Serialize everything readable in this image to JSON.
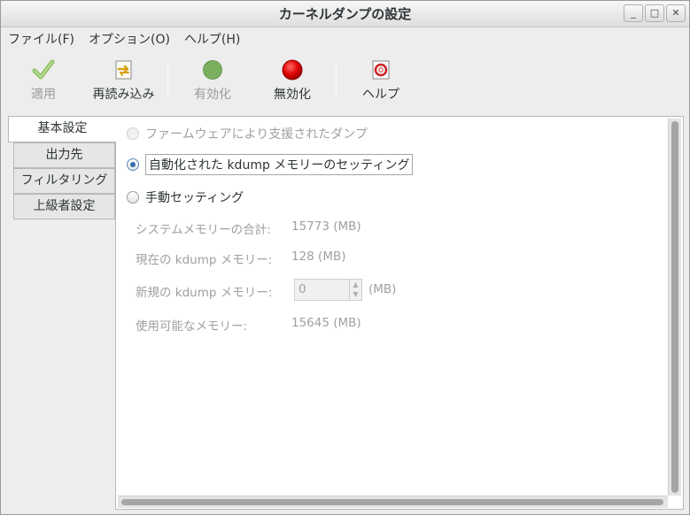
{
  "window": {
    "title": "カーネルダンプの設定",
    "minimize_label": "_",
    "maximize_label": "□",
    "close_label": "✕"
  },
  "menubar": {
    "items": [
      {
        "label": "ファイル(F)"
      },
      {
        "label": "オプション(O)"
      },
      {
        "label": "ヘルプ(H)"
      }
    ]
  },
  "toolbar": {
    "apply": {
      "label": "適用",
      "enabled": false,
      "icon": "check-icon"
    },
    "reload": {
      "label": "再読み込み",
      "enabled": true,
      "icon": "reload-icon"
    },
    "enable": {
      "label": "有効化",
      "enabled": false,
      "icon": "green-circle-icon"
    },
    "disable": {
      "label": "無効化",
      "enabled": true,
      "icon": "red-circle-icon"
    },
    "help": {
      "label": "ヘルプ",
      "enabled": true,
      "icon": "help-icon"
    }
  },
  "tabs": [
    {
      "label": "基本設定",
      "active": true
    },
    {
      "label": "出力先",
      "active": false
    },
    {
      "label": "フィルタリング",
      "active": false
    },
    {
      "label": "上級者設定",
      "active": false
    }
  ],
  "basic": {
    "options": [
      {
        "label": "ファームウェアにより支援されたダンプ",
        "checked": false,
        "enabled": false
      },
      {
        "label": "自動化された kdump メモリーのセッティング",
        "checked": true,
        "enabled": true
      },
      {
        "label": "手動セッティング",
        "checked": false,
        "enabled": true
      }
    ],
    "system_memory": {
      "label": "システムメモリーの合計:",
      "value": "15773 (MB)"
    },
    "current_kdump": {
      "label": "現在の kdump メモリー:",
      "value": "128 (MB)"
    },
    "new_kdump": {
      "label": "新規の kdump メモリー:",
      "value": "0",
      "unit": "(MB)"
    },
    "usable_memory": {
      "label": "使用可能なメモリー:",
      "value": "15645 (MB)"
    }
  },
  "colors": {
    "accent": "#3b6fb0",
    "disabled_text": "#a0a0a0",
    "disable_button_red": "#cc0000",
    "enable_button_green": "#6aa84f"
  }
}
